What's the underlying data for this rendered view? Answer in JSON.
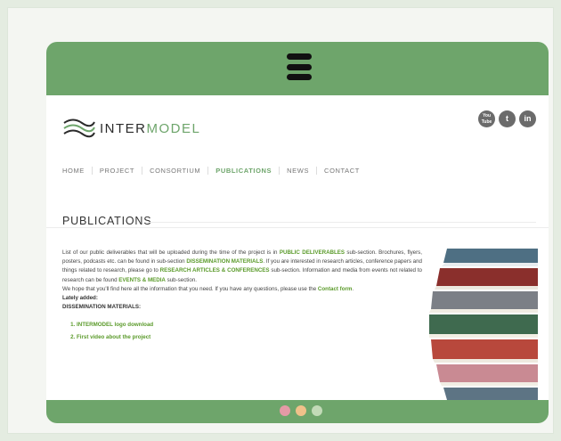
{
  "brand": {
    "name_part1": "INTER",
    "name_part2": "MODEL"
  },
  "social": [
    {
      "label": "You Tube",
      "icon": "youtube-icon"
    },
    {
      "label": "t",
      "icon": "twitter-icon"
    },
    {
      "label": "in",
      "icon": "linkedin-icon"
    }
  ],
  "nav": [
    "HOME",
    "PROJECT",
    "CONSORTIUM",
    "PUBLICATIONS",
    "NEWS",
    "CONTACT"
  ],
  "active_nav": "PUBLICATIONS",
  "page_title": "PUBLICATIONS",
  "intro": {
    "t1": "List of our public deliverables that will be uploaded during the time of the project is in ",
    "h1": "PUBLIC DELIVERABLES",
    "t2": " sub-section. Brochures, flyers, posters, podcasts etc. can be found in sub-section ",
    "h2": "DISSEMINATION MATERIALS",
    "t3": ". If you are interested in research articles, conference papers and things related to research, please go to ",
    "h3": "RESEARCH ARTICLES & CONFERENCES",
    "t4": " sub-section. Information and media from events not related to research can be found ",
    "h4": "EVENTS & MEDIA",
    "t5": " sub-section.",
    "t6": "We hope that you'll find here all the information that you need. If you have any questions, please use the ",
    "contact_link": "Contact form",
    "t7": "."
  },
  "latest_heading": "Lately added:",
  "latest_category": "DISSEMINATION MATERIALS:",
  "downloads": [
    "INTERMODEL logo download",
    "First video about the project"
  ],
  "colors": {
    "accent": "#6ea56b",
    "link": "#5a9a2a",
    "dot1": "#e59aa6",
    "dot2": "#f0c18a",
    "dot3": "#c2dab7"
  }
}
